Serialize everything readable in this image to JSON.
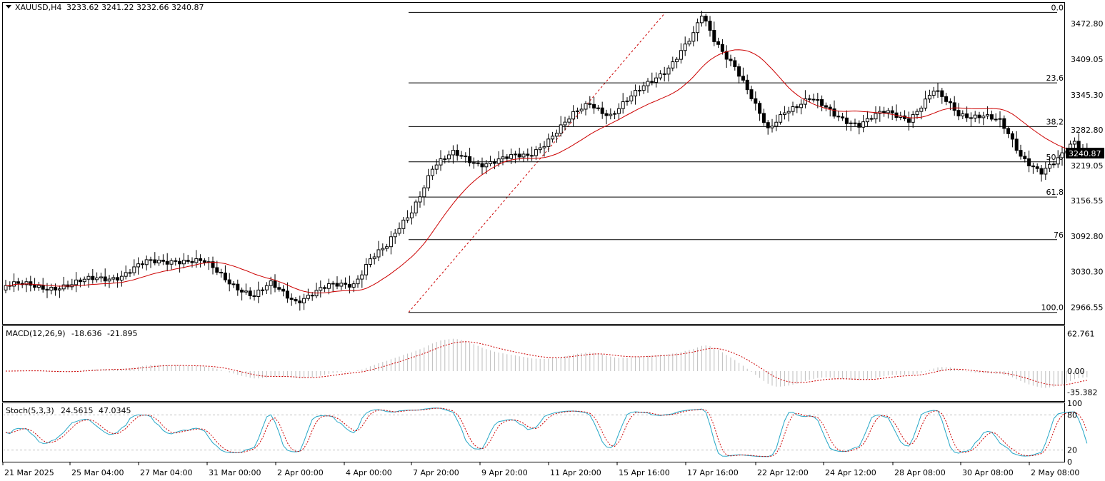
{
  "chart_data": {
    "type": "candlestick",
    "symbol_header": "XAUUSD,H4",
    "ohlc_readout": "3233.62 3241.22 3232.66 3240.87",
    "last_price": "3240.87",
    "colors": {
      "bull_body": "#ffffff",
      "bear_body": "#000000",
      "ma_line": "#cc0000",
      "fib_line": "#000000",
      "fib_trend": "#cc0000",
      "macd_hist": "#bdbdbd",
      "macd_signal": "#cc0000",
      "stoch_main": "#26a7c7",
      "stoch_signal": "#cc0000",
      "grid": "#c0c0c0"
    },
    "price_axis": {
      "ylim": [
        2935,
        3510
      ],
      "ticks": [
        "3472.80",
        "3409.05",
        "3345.30",
        "3282.80",
        "3219.05",
        "3156.55",
        "3092.80",
        "3030.30",
        "2966.55"
      ]
    },
    "fibonacci": {
      "levels": [
        {
          "label": "0.0",
          "price": 3493
        },
        {
          "label": "23.6",
          "price": 3367
        },
        {
          "label": "38.2",
          "price": 3289
        },
        {
          "label": "50.0",
          "price": 3226
        },
        {
          "label": "61.8",
          "price": 3163
        },
        {
          "label": "76",
          "price": 3087
        },
        {
          "label": "100.0",
          "price": 2957
        }
      ]
    },
    "time_axis": {
      "labels": [
        "21 Mar 2025",
        "25 Mar 04:00",
        "27 Mar 04:00",
        "31 Mar 00:00",
        "2 Apr 00:00",
        "4 Apr 00:00",
        "7 Apr 20:00",
        "9 Apr 20:00",
        "11 Apr 20:00",
        "15 Apr 16:00",
        "17 Apr 16:00",
        "22 Apr 12:00",
        "24 Apr 12:00",
        "28 Apr 08:00",
        "30 Apr 08:00",
        "2 May 08:00"
      ]
    },
    "waypoints": [
      [
        0,
        3005
      ],
      [
        8,
        3003
      ],
      [
        16,
        3005
      ],
      [
        22,
        3018
      ],
      [
        28,
        3024
      ],
      [
        34,
        3044
      ],
      [
        41,
        3053
      ],
      [
        48,
        3044
      ],
      [
        55,
        3009
      ],
      [
        60,
        2985
      ],
      [
        64,
        3005
      ],
      [
        70,
        2980
      ],
      [
        78,
        3001
      ],
      [
        84,
        3010
      ],
      [
        88,
        3055
      ],
      [
        92,
        3072
      ],
      [
        98,
        3140
      ],
      [
        103,
        3217
      ],
      [
        108,
        3238
      ],
      [
        114,
        3225
      ],
      [
        120,
        3230
      ],
      [
        126,
        3236
      ],
      [
        132,
        3275
      ],
      [
        137,
        3307
      ],
      [
        141,
        3330
      ],
      [
        146,
        3312
      ],
      [
        152,
        3345
      ],
      [
        160,
        3398
      ],
      [
        166,
        3450
      ],
      [
        168,
        3485
      ],
      [
        171,
        3445
      ],
      [
        176,
        3400
      ],
      [
        181,
        3322
      ],
      [
        184,
        3280
      ],
      [
        188,
        3320
      ],
      [
        194,
        3338
      ],
      [
        200,
        3310
      ],
      [
        206,
        3295
      ],
      [
        212,
        3312
      ],
      [
        218,
        3305
      ],
      [
        224,
        3352
      ],
      [
        230,
        3310
      ],
      [
        236,
        3312
      ],
      [
        240,
        3295
      ],
      [
        245,
        3236
      ],
      [
        250,
        3212
      ],
      [
        254,
        3228
      ],
      [
        258,
        3258
      ],
      [
        261,
        3241
      ]
    ],
    "macd": {
      "label": "MACD(12,26,9)",
      "main": "-18.636",
      "signal": "-21.895",
      "ylim": [
        -50,
        75
      ],
      "ticks": [
        "62.761",
        "0.00",
        "-35.382"
      ]
    },
    "stochastic": {
      "label": "Stoch(5,3,3)",
      "main": "24.5615",
      "signal": "47.0345",
      "ylim": [
        0,
        100
      ],
      "ticks": [
        "100",
        "80",
        "20",
        "0"
      ],
      "levels": [
        20,
        80
      ]
    }
  }
}
